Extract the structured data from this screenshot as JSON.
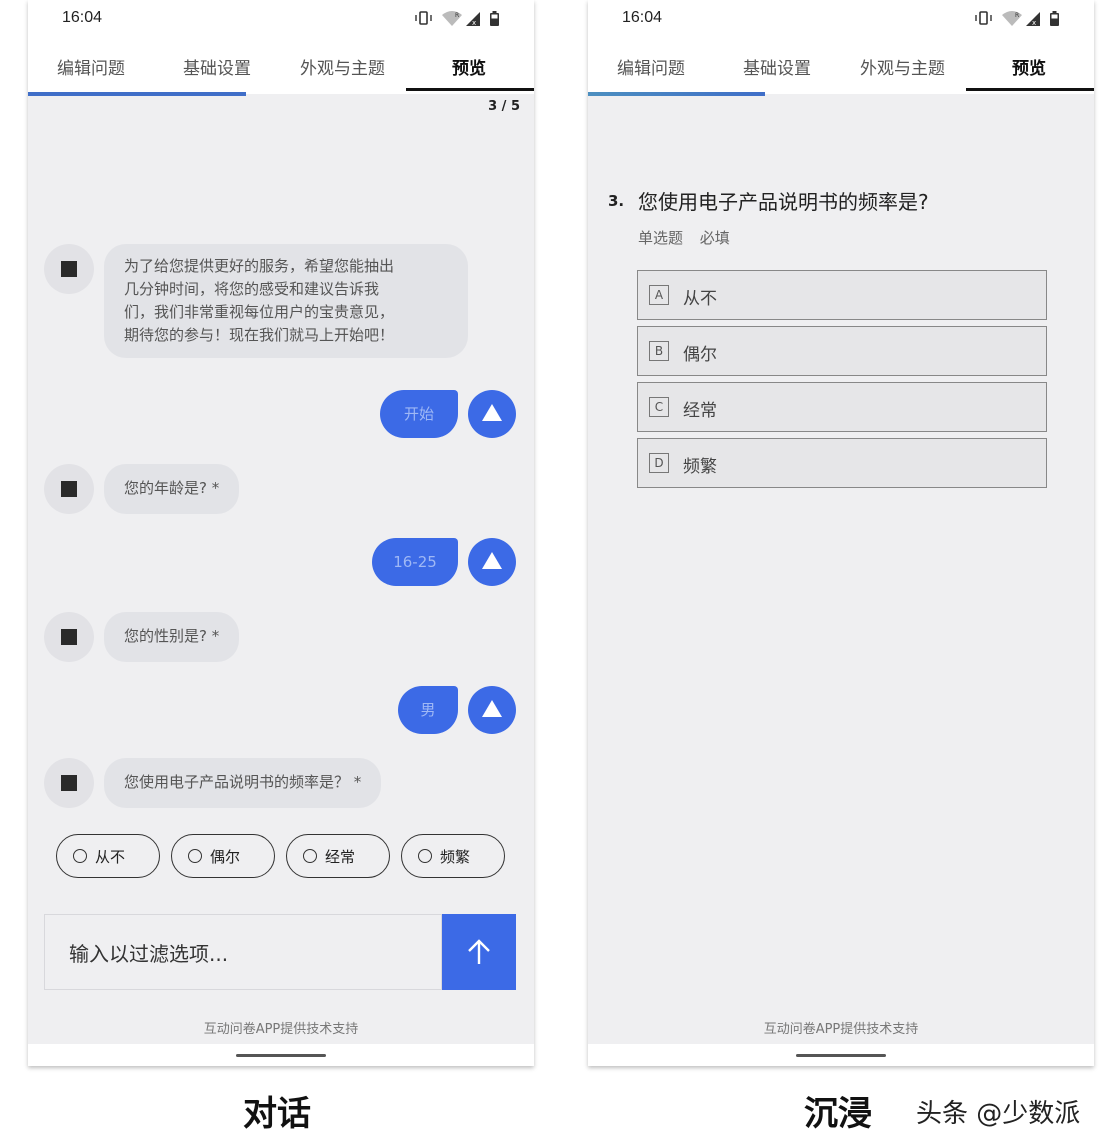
{
  "status_bar": {
    "time": "16:04"
  },
  "tabs": [
    "编辑问题",
    "基础设置",
    "外观与主题",
    "预览"
  ],
  "chat_view": {
    "counter": "3 / 5",
    "progress": 0.43,
    "intro_lines": [
      "为了给您提供更好的服务，希望您能抽出",
      "几分钟时间，将您的感受和建议告诉我",
      "们，我们非常重视每位用户的宝贵意见，",
      "期待您的参与！现在我们就马上开始吧！"
    ],
    "start_reply": "开始",
    "q_age": "您的年龄是? *",
    "age_reply": "16-25",
    "q_gender": "您的性别是? *",
    "gender_reply": "男",
    "q_freq": "您使用电子产品说明书的频率是？ *",
    "options": [
      "从不",
      "偶尔",
      "经常",
      "频繁"
    ],
    "input_placeholder": "输入以过滤选项...",
    "footer": "互动问卷APP提供技术支持"
  },
  "immersive_view": {
    "progress": 0.35,
    "question_number": "3.",
    "question_title": "您使用电子产品说明书的频率是?",
    "question_type": "单选题",
    "question_required": "必填",
    "options": [
      {
        "letter": "A",
        "label": "从不"
      },
      {
        "letter": "B",
        "label": "偶尔"
      },
      {
        "letter": "C",
        "label": "经常"
      },
      {
        "letter": "D",
        "label": "频繁"
      }
    ],
    "footer": "互动问卷APP提供技术支持"
  },
  "captions": {
    "left": "对话",
    "right": "沉浸"
  },
  "watermark": "头条 @少数派",
  "colors": {
    "accent": "#3c6ae6",
    "progress": "#3f6ec8"
  },
  "icons": [
    "vibrate-icon",
    "wifi-icon",
    "signal-icon",
    "battery-icon",
    "square-avatar-icon",
    "triangle-avatar-icon",
    "arrow-up-icon"
  ]
}
